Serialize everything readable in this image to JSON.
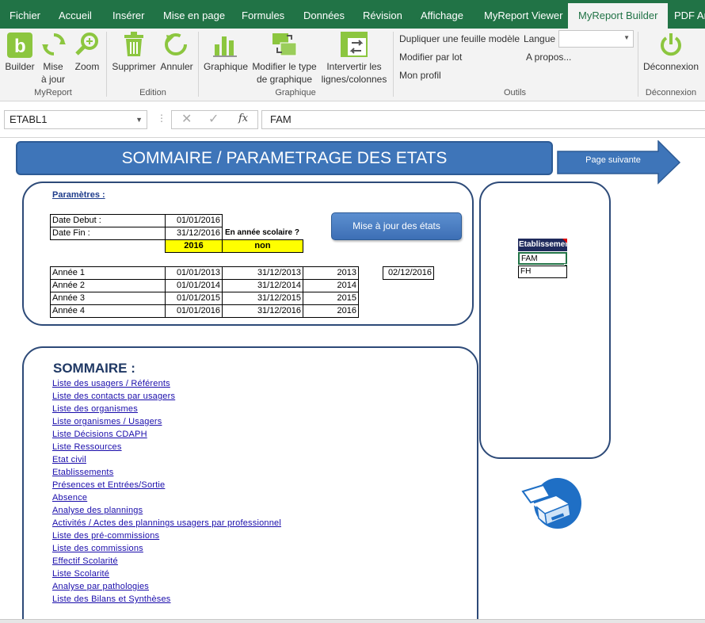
{
  "tabs": [
    "Fichier",
    "Accueil",
    "Insérer",
    "Mise en page",
    "Formules",
    "Données",
    "Révision",
    "Affichage",
    "MyReport Viewer",
    "MyReport Builder",
    "PDF Arc"
  ],
  "ribbon": {
    "myreport": {
      "builder": "Builder",
      "mise_a_jour_1": "Mise",
      "mise_a_jour_2": "à jour",
      "zoom": "Zoom",
      "label": "MyReport"
    },
    "edition": {
      "supprimer": "Supprimer",
      "annuler": "Annuler",
      "label": "Edition"
    },
    "graphique": {
      "graphique": "Graphique",
      "modifier_1": "Modifier le type",
      "modifier_2": "de graphique",
      "intervertir_1": "Intervertir les",
      "intervertir_2": "lignes/colonnes",
      "label": "Graphique"
    },
    "outils": {
      "dupliquer": "Dupliquer une feuille modèle",
      "langue": "Langue",
      "langue_value": "",
      "modifier_lot": "Modifier par lot",
      "apropos": "A propos...",
      "profil": "Mon profil",
      "label": "Outils"
    },
    "deconnexion": {
      "button": "Déconnexion",
      "label": "Déconnexion"
    }
  },
  "formula_bar": {
    "name_box": "ETABL1",
    "value": "FAM"
  },
  "sheet": {
    "title": "SOMMAIRE / PARAMETRAGE DES ETATS",
    "next_page": "Page suivante",
    "params_label": "Paramètres :",
    "date_debut_label": "Date Debut :",
    "date_debut": "01/01/2016",
    "date_fin_label": "Date Fin :",
    "date_fin": "31/12/2016",
    "annee_scolaire_label": "En année scolaire ?",
    "year_value": "2016",
    "scolaire_value": "non",
    "update_button": "Mise à jour des états",
    "years": [
      {
        "label": "Année 1",
        "start": "01/01/2013",
        "end": "31/12/2013",
        "year": "2013"
      },
      {
        "label": "Année 2",
        "start": "01/01/2014",
        "end": "31/12/2014",
        "year": "2014"
      },
      {
        "label": "Année 3",
        "start": "01/01/2015",
        "end": "31/12/2015",
        "year": "2015"
      },
      {
        "label": "Année 4",
        "start": "01/01/2016",
        "end": "31/12/2016",
        "year": "2016"
      }
    ],
    "extra_date": "02/12/2016",
    "sommaire_title": "SOMMAIRE :",
    "links": [
      "Liste des usagers / Référents",
      "Liste des contacts par usagers",
      "Liste des organismes",
      "Liste organismes / Usagers",
      "Liste Décisions CDAPH",
      "Liste Ressources",
      "Etat civil",
      "Etablissements",
      "Présences et Entrées/Sortie",
      "Absence",
      "Analyse des plannings",
      "Activités / Actes des plannings usagers par professionnel",
      "Liste des pré-commissions",
      "Liste des commissions",
      "Effectif Scolarité",
      "Liste Scolarité",
      "Analyse par pathologies",
      "Liste des Bilans et Synthèses"
    ],
    "etablissement": {
      "header": "Etablissement",
      "values": [
        "FAM",
        "FH"
      ]
    }
  },
  "colors": {
    "ribbon_green": "#217346",
    "banner_blue": "#3e75b9",
    "box_border": "#2d4a78",
    "highlight_yellow": "#ffff00",
    "link_blue": "#1a0dab"
  }
}
